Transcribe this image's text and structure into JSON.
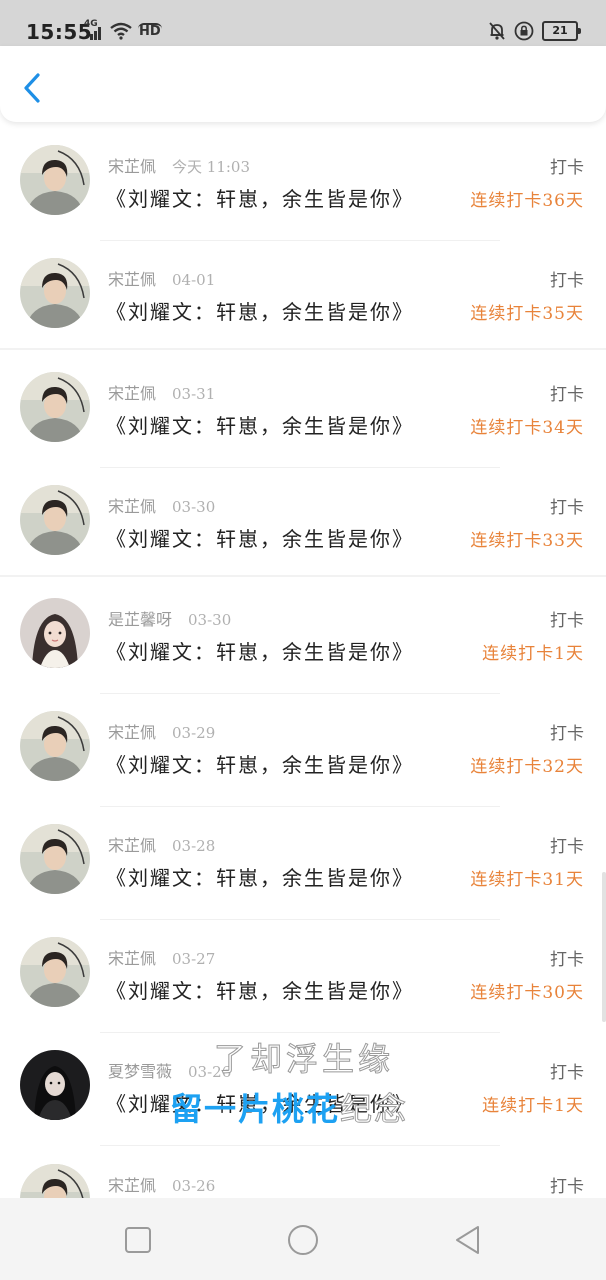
{
  "status_bar": {
    "time": "15:55",
    "network": "4G",
    "hd": "HD",
    "battery": "21"
  },
  "header": {
    "back_icon": "chevron-left-icon"
  },
  "rows": [
    {
      "name": "宋芷佩",
      "date": "今天 11:03",
      "title": "《刘耀文：轩崽，余生皆是你》",
      "action": "打卡",
      "streak": "连续打卡36天",
      "avatar": "boy"
    },
    {
      "name": "宋芷佩",
      "date": "04-01",
      "title": "《刘耀文：轩崽，余生皆是你》",
      "action": "打卡",
      "streak": "连续打卡35天",
      "avatar": "boy"
    },
    {
      "name": "宋芷佩",
      "date": "03-31",
      "title": "《刘耀文：轩崽，余生皆是你》",
      "action": "打卡",
      "streak": "连续打卡34天",
      "avatar": "boy"
    },
    {
      "name": "宋芷佩",
      "date": "03-30",
      "title": "《刘耀文：轩崽，余生皆是你》",
      "action": "打卡",
      "streak": "连续打卡33天",
      "avatar": "boy"
    },
    {
      "name": "是芷馨呀",
      "date": "03-30",
      "title": "《刘耀文：轩崽，余生皆是你》",
      "action": "打卡",
      "streak": "连续打卡1天",
      "avatar": "girl"
    },
    {
      "name": "宋芷佩",
      "date": "03-29",
      "title": "《刘耀文：轩崽，余生皆是你》",
      "action": "打卡",
      "streak": "连续打卡32天",
      "avatar": "boy"
    },
    {
      "name": "宋芷佩",
      "date": "03-28",
      "title": "《刘耀文：轩崽，余生皆是你》",
      "action": "打卡",
      "streak": "连续打卡31天",
      "avatar": "boy"
    },
    {
      "name": "宋芷佩",
      "date": "03-27",
      "title": "《刘耀文：轩崽，余生皆是你》",
      "action": "打卡",
      "streak": "连续打卡30天",
      "avatar": "boy"
    },
    {
      "name": "夏梦雪薇",
      "date": "03-26",
      "title": "《刘耀文：轩崽，余生皆是你》",
      "action": "打卡",
      "streak": "连续打卡1天",
      "avatar": "dark"
    },
    {
      "name": "宋芷佩",
      "date": "03-26",
      "title": "",
      "action": "打卡",
      "streak": "",
      "avatar": "boy"
    }
  ],
  "overlay": {
    "line1": "了却浮生缘",
    "line2": "留一片桃花",
    "line2_fade": "纪念"
  },
  "nav_bar": {
    "recent_icon": "square-icon",
    "home_icon": "circle-icon",
    "back_icon": "triangle-back-icon"
  },
  "colors": {
    "streak": "#e8833a",
    "accent": "#1da1f2",
    "status_bar_bg": "#d6d6d6"
  }
}
